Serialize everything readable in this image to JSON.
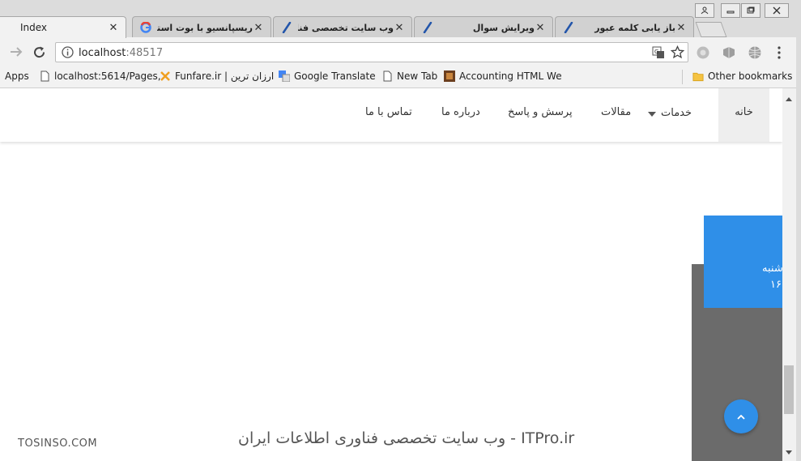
{
  "browser": {
    "tabs": [
      {
        "title": "Index",
        "favicon": "page-icon",
        "active": true
      },
      {
        "title": "ریسپانسیو با بوت استرپ -",
        "favicon": "google-icon",
        "active": false
      },
      {
        "title": "وب سایت تخصصی فناوری",
        "favicon": "quill-icon",
        "active": false
      },
      {
        "title": "ویرایش سوال",
        "favicon": "quill-icon",
        "active": false
      },
      {
        "title": "باز یابی کلمه عبور",
        "favicon": "quill-icon",
        "active": false
      }
    ],
    "address": {
      "host": "localhost",
      "port": ":48517"
    },
    "bookmarks": [
      {
        "label": "Apps",
        "icon": "apps-grid-icon"
      },
      {
        "label": "localhost:5614/Pages,",
        "icon": "page-icon"
      },
      {
        "label": "Funfare.ir | ارزان ترین",
        "icon": "funfare-icon"
      },
      {
        "label": "Google Translate",
        "icon": "translate-icon"
      },
      {
        "label": "New Tab",
        "icon": "page-icon"
      },
      {
        "label": "Accounting HTML We",
        "icon": "image-icon"
      }
    ],
    "other_bookmarks": "Other bookmarks"
  },
  "site": {
    "nav": {
      "home": "خانه",
      "services": "خدمات",
      "articles": "مقالات",
      "qa": "پرسش و پاسخ",
      "about": "درباره ما",
      "contact": "تماس با ما"
    },
    "card": {
      "line1": "شنبه",
      "line2": "۱۶"
    }
  },
  "watermark": {
    "left": "TOSINSO.COM",
    "center": "ITPro.ir - وب سایت تخصصی فناوری اطلاعات ایران"
  },
  "colors": {
    "accent": "#2f8fe8",
    "gray_block": "#6b6b6b"
  }
}
